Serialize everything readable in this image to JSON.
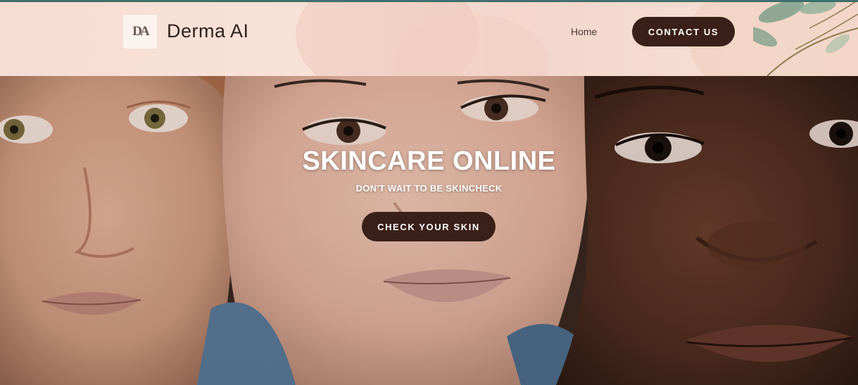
{
  "brand": {
    "logo_text": "DA",
    "name": "Derma AI"
  },
  "nav": {
    "home_label": "Home",
    "contact_label": "CONTACT US"
  },
  "hero": {
    "title": "SKINCARE ONLINE",
    "subtitle": "DON'T WAIT TO BE SKINCHECK",
    "cta_label": "CHECK YOUR SKIN",
    "image_alt": "photo-three-faces"
  },
  "colors": {
    "header_bg": "#f6ddd3",
    "button_bg": "#3a2019",
    "button_text": "#ffffff",
    "accent_line": "#3f6f6c",
    "leaf": "#7fa08a"
  },
  "icons": {
    "logo": "da-monogram-icon",
    "decoration": "eucalyptus-leaves-icon"
  }
}
